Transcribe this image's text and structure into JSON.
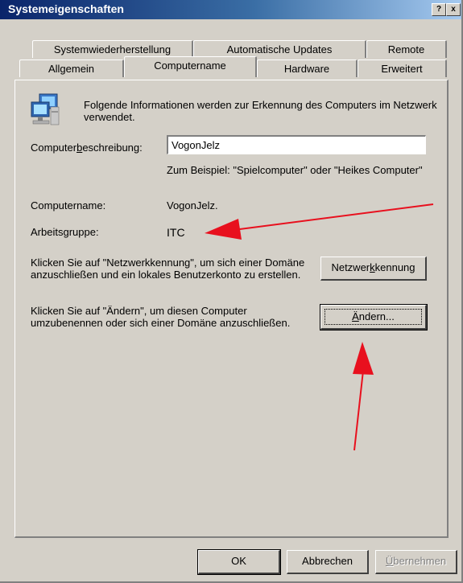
{
  "window": {
    "title": "Systemeigenschaften",
    "help_btn": "?",
    "close_btn": "x"
  },
  "tabs": {
    "row1": [
      "Systemwiederherstellung",
      "Automatische Updates",
      "Remote"
    ],
    "row2": [
      "Allgemein",
      "Computername",
      "Hardware",
      "Erweitert"
    ]
  },
  "info": {
    "text": "Folgende Informationen werden zur Erkennung des Computers im Netzwerk verwendet."
  },
  "desc": {
    "label_pre": "Computer",
    "label_u": "b",
    "label_post": "eschreibung:",
    "value": "VogonJelz",
    "example": "Zum Beispiel: \"Spielcomputer\" oder \"Heikes Computer\""
  },
  "computer": {
    "name_label": "Computername:",
    "name_value": "VogonJelz.",
    "workgroup_label": "Arbeitsgruppe:",
    "workgroup_value": "ITC"
  },
  "network": {
    "text": "Klicken Sie auf \"Netzwerkkennung\", um sich einer Domäne anzuschließen und ein lokales Benutzerkonto zu erstellen.",
    "btn_pre": "Netzwer",
    "btn_u": "k",
    "btn_post": "kennung"
  },
  "change": {
    "text": "Klicken Sie auf \"Ändern\", um diesen Computer umzubenennen oder sich einer Domäne anzuschließen.",
    "btn_u": "Ä",
    "btn_post": "ndern..."
  },
  "footer": {
    "ok": "OK",
    "cancel": "Abbrechen",
    "apply_u": "Ü",
    "apply_post": "bernehmen"
  },
  "annotation_color": "#e8101e"
}
